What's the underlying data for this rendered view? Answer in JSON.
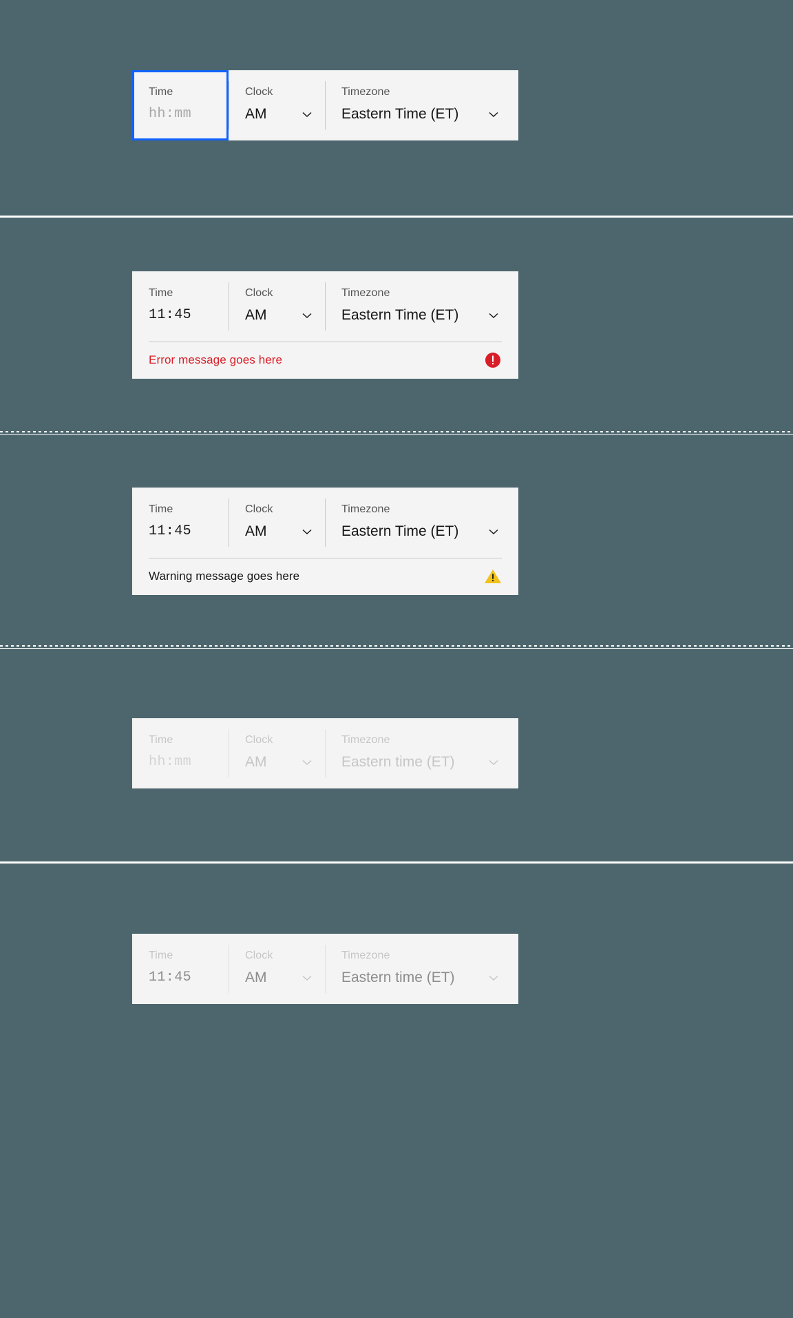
{
  "page": {
    "background_color": "#4d666d",
    "field_background": "#f4f4f4",
    "focus_color": "#0f62fe",
    "error_color": "#da1e28",
    "warning_color": "#f1c21b"
  },
  "labels": {
    "time": "Time",
    "clock": "Clock",
    "timezone": "Timezone"
  },
  "states": [
    {
      "id": "focus",
      "time_value": "hh:mm",
      "time_is_placeholder": true,
      "clock_value": "AM",
      "timezone_value": "Eastern Time (ET)",
      "message": null,
      "message_icon": null
    },
    {
      "id": "error",
      "time_value": "11:45",
      "time_is_placeholder": false,
      "clock_value": "AM",
      "timezone_value": "Eastern Time (ET)",
      "message": "Error message goes here",
      "message_icon": "error-filled-icon"
    },
    {
      "id": "warning",
      "time_value": "11:45",
      "time_is_placeholder": false,
      "clock_value": "AM",
      "timezone_value": "Eastern Time (ET)",
      "message": "Warning message goes here",
      "message_icon": "warning-filled-icon"
    },
    {
      "id": "disabled-empty",
      "time_value": "hh:mm",
      "time_is_placeholder": true,
      "clock_value": "AM",
      "timezone_value": "Eastern time (ET)",
      "message": null,
      "message_icon": null
    },
    {
      "id": "disabled-filled",
      "time_value": "11:45",
      "time_is_placeholder": false,
      "clock_value": "AM",
      "timezone_value": "Eastern time (ET)",
      "message": null,
      "message_icon": null
    }
  ],
  "icons": {
    "chevron": "chevron-down-icon",
    "error": "error-filled-icon",
    "warning": "warning-filled-icon"
  }
}
